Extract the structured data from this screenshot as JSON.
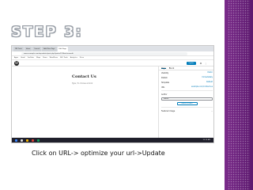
{
  "slide": {
    "title": "STEP 3:",
    "caption": "Click on URL-> optimize your url->Update"
  },
  "browser": {
    "tabs": [
      "DM Tools",
      "Inbox",
      "Search",
      "Add New Page",
      "Edit Page"
    ],
    "address": "www.example.com/wp-admin/post.php?post=123&action=edit",
    "bookmarks": [
      "Apps",
      "Gmail",
      "YouTube",
      "Maps",
      "News",
      "WordPress",
      "SEO Tools",
      "Analytics",
      "Drive"
    ]
  },
  "wp": {
    "logo": "W",
    "publish_label": "Update",
    "page_title": "Contact Us",
    "block_hint": "Type / to choose a block"
  },
  "sidebar": {
    "tabs": [
      "Page",
      "Block"
    ],
    "rows": [
      {
        "label": "Visibility",
        "value": "Public"
      },
      {
        "label": "Publish",
        "value": "Immediately"
      },
      {
        "label": "Template",
        "value": "Default"
      },
      {
        "label": "URL",
        "value": "example.com/contact-us"
      }
    ],
    "author_label": "Author",
    "author_value": "admin",
    "trash_label": "Move to trash",
    "section_label": "Featured image"
  },
  "taskbar": {
    "clock": "10:15 AM"
  },
  "colors": {
    "accent": "#007cba",
    "side_strip": "#6b2380"
  }
}
